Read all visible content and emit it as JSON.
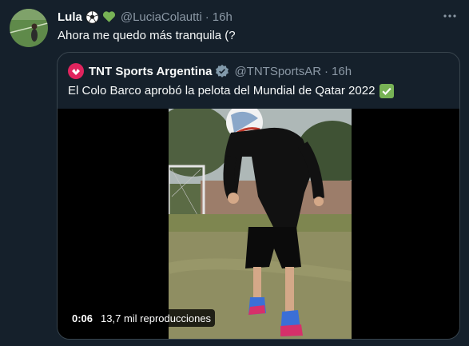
{
  "tweet": {
    "name": "Lula",
    "emojis": [
      "soccer-ball",
      "green-heart"
    ],
    "handle": "@LuciaColautti",
    "separator": "·",
    "time": "16h",
    "text": "Ahora me quedo más tranquila (?"
  },
  "quote": {
    "name": "TNT Sports Argentina",
    "verified": true,
    "handle": "@TNTSportsAR",
    "separator": "·",
    "time": "16h",
    "text": "El Colo Barco aprobó la pelota del Mundial de Qatar 2022",
    "text_emoji": "check-mark-button",
    "video": {
      "duration": "0:06",
      "views": "13,7 mil reproducciones"
    }
  },
  "colors": {
    "background": "#15202b",
    "secondary_text": "#8b98a5",
    "border": "#38444d",
    "brand_logo": "#e0245e",
    "verified": "#829aab"
  }
}
